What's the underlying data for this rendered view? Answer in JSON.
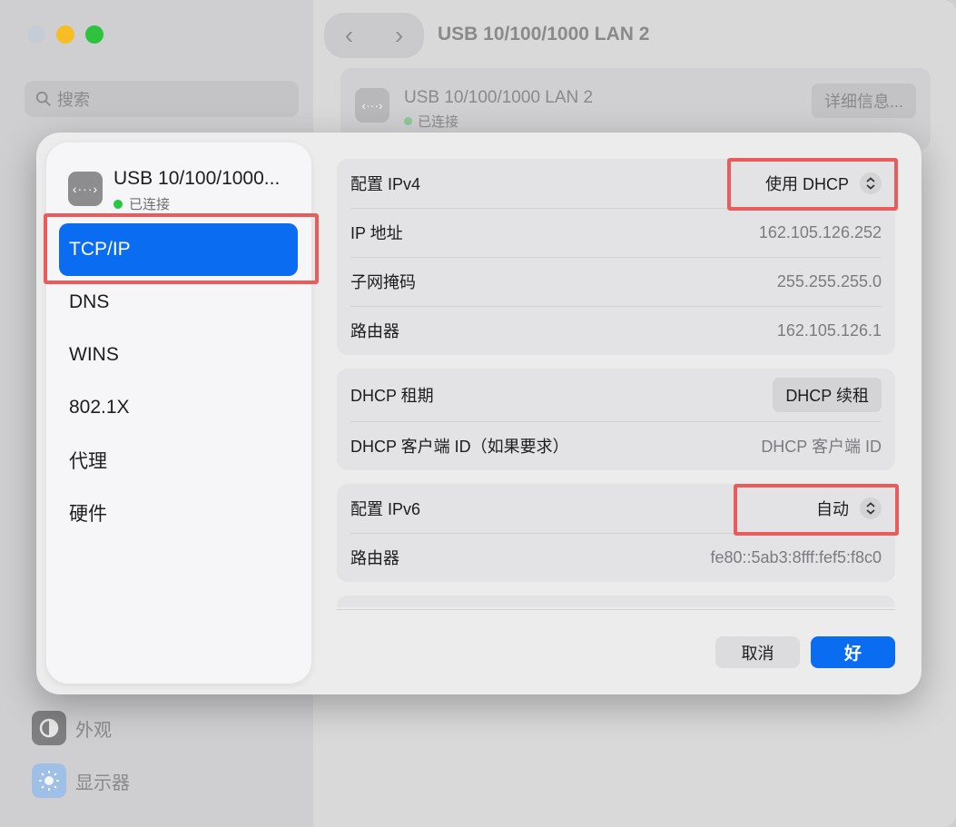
{
  "background": {
    "search_placeholder": "搜索",
    "window_title": "USB 10/100/1000 LAN 2",
    "device_name": "USB 10/100/1000 LAN 2",
    "device_status": "已连接",
    "detail_button": "详细信息...",
    "sidebar_items": [
      {
        "label": "外观",
        "icon": "appearance-icon"
      },
      {
        "label": "显示器",
        "icon": "display-icon"
      }
    ]
  },
  "dialog": {
    "device_name": "USB 10/100/1000...",
    "device_status": "已连接",
    "nav": [
      "TCP/IP",
      "DNS",
      "WINS",
      "802.1X",
      "代理",
      "硬件"
    ],
    "active_nav": "TCP/IP",
    "ipv4_group": {
      "configure_label": "配置 IPv4",
      "configure_value": "使用 DHCP",
      "ip_label": "IP 地址",
      "ip_value": "162.105.126.252",
      "subnet_label": "子网掩码",
      "subnet_value": "255.255.255.0",
      "router_label": "路由器",
      "router_value": "162.105.126.1"
    },
    "dhcp_group": {
      "lease_label": "DHCP 租期",
      "renew_button": "DHCP 续租",
      "client_id_label": "DHCP 客户端 ID（如果要求）",
      "client_id_placeholder": "DHCP 客户端 ID"
    },
    "ipv6_group": {
      "configure_label": "配置 IPv6",
      "configure_value": "自动",
      "router_label": "路由器",
      "router_value": "fe80::5ab3:8fff:fef5:f8c0"
    },
    "buttons": {
      "cancel": "取消",
      "ok": "好"
    }
  },
  "colors": {
    "accent": "#0A6CF0",
    "highlight": "#EC5B5B",
    "status_green": "#28C840"
  }
}
